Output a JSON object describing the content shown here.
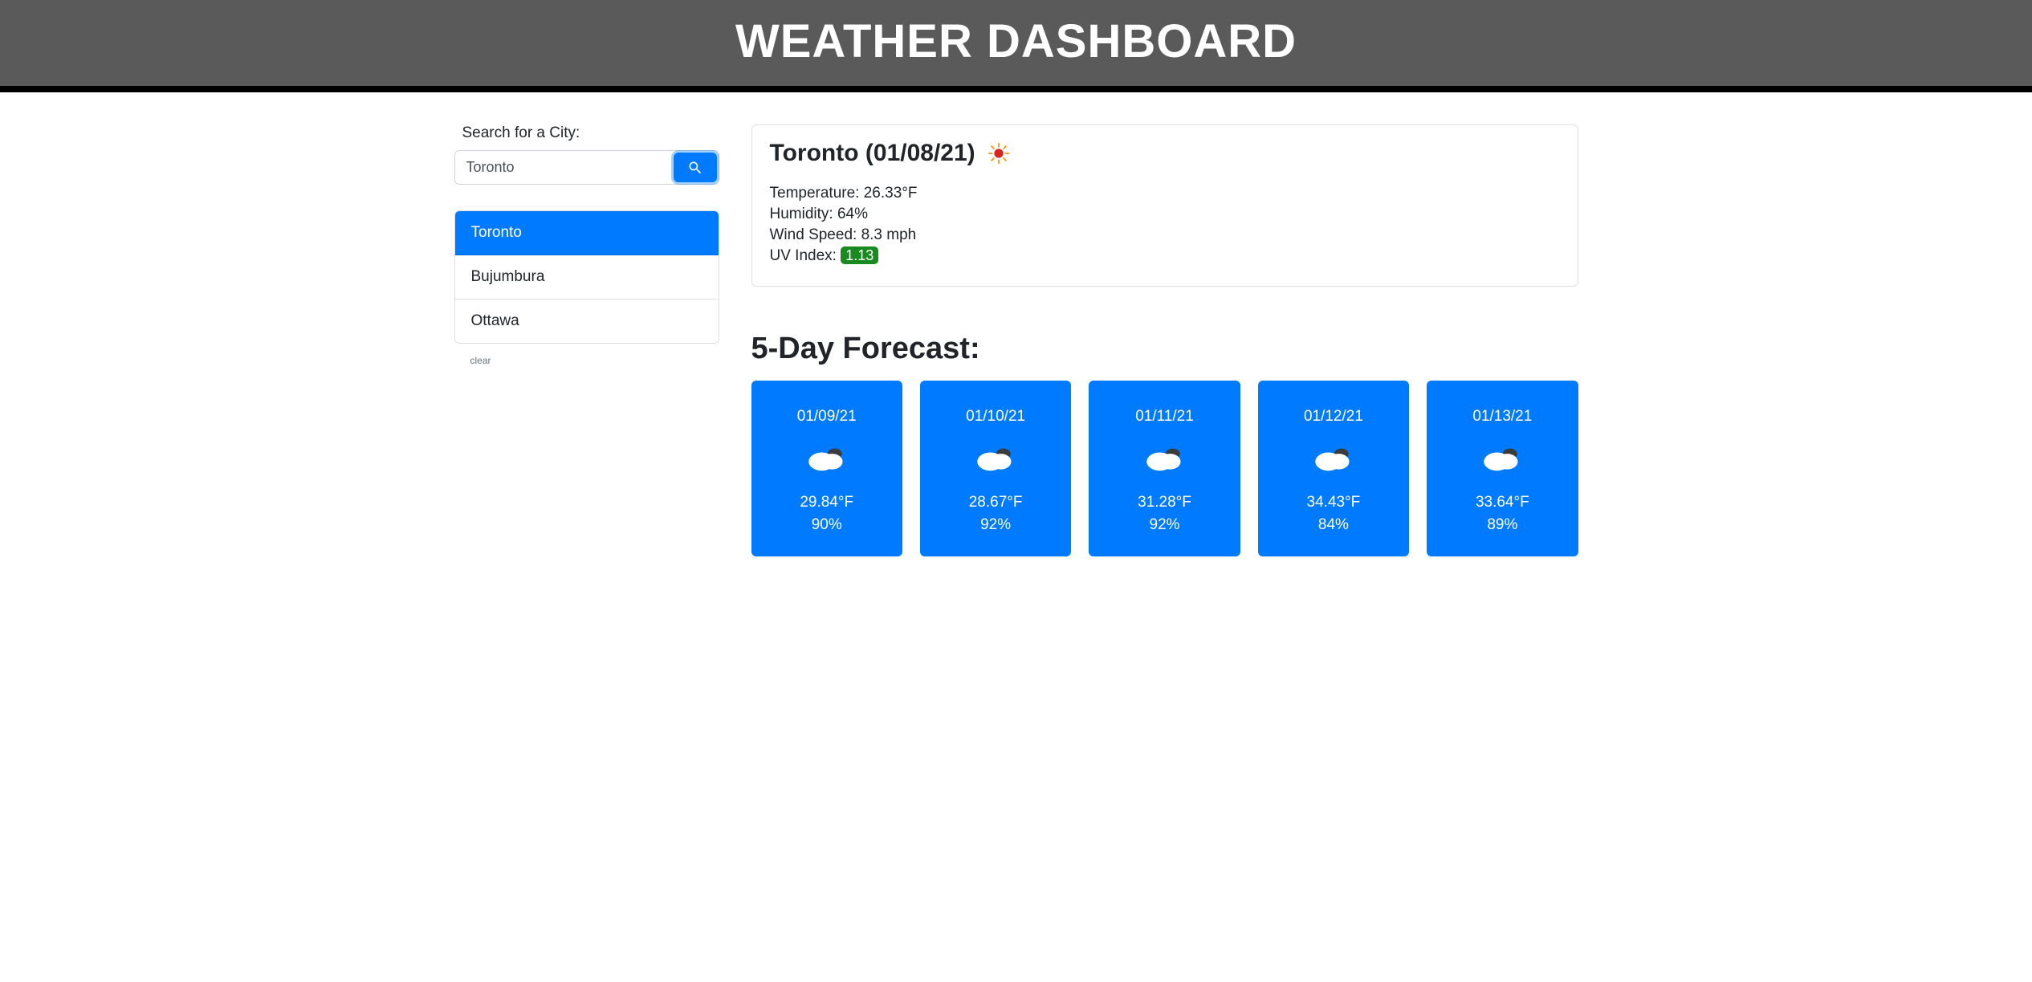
{
  "header": {
    "title": "WEATHER DASHBOARD"
  },
  "search": {
    "label": "Search for a City:",
    "value": "Toronto",
    "clear": "clear"
  },
  "history": [
    {
      "name": "Toronto",
      "active": true
    },
    {
      "name": "Bujumbura",
      "active": false
    },
    {
      "name": "Ottawa",
      "active": false
    }
  ],
  "current": {
    "city": "Toronto",
    "date": "01/08/21",
    "heading": "Toronto (01/08/21)",
    "temperature_label": "Temperature:",
    "temperature": "26.33°F",
    "humidity_label": "Humidity:",
    "humidity": "64%",
    "wind_label": "Wind Speed:",
    "wind": "8.3 mph",
    "uv_label": "UV Index:",
    "uv": "1.13",
    "uv_color": "#198a1f"
  },
  "forecast_title": "5-Day Forecast:",
  "forecast": [
    {
      "date": "01/09/21",
      "temp": "29.84°F",
      "humidity": "90%"
    },
    {
      "date": "01/10/21",
      "temp": "28.67°F",
      "humidity": "92%"
    },
    {
      "date": "01/11/21",
      "temp": "31.28°F",
      "humidity": "92%"
    },
    {
      "date": "01/12/21",
      "temp": "34.43°F",
      "humidity": "84%"
    },
    {
      "date": "01/13/21",
      "temp": "33.64°F",
      "humidity": "89%"
    }
  ]
}
